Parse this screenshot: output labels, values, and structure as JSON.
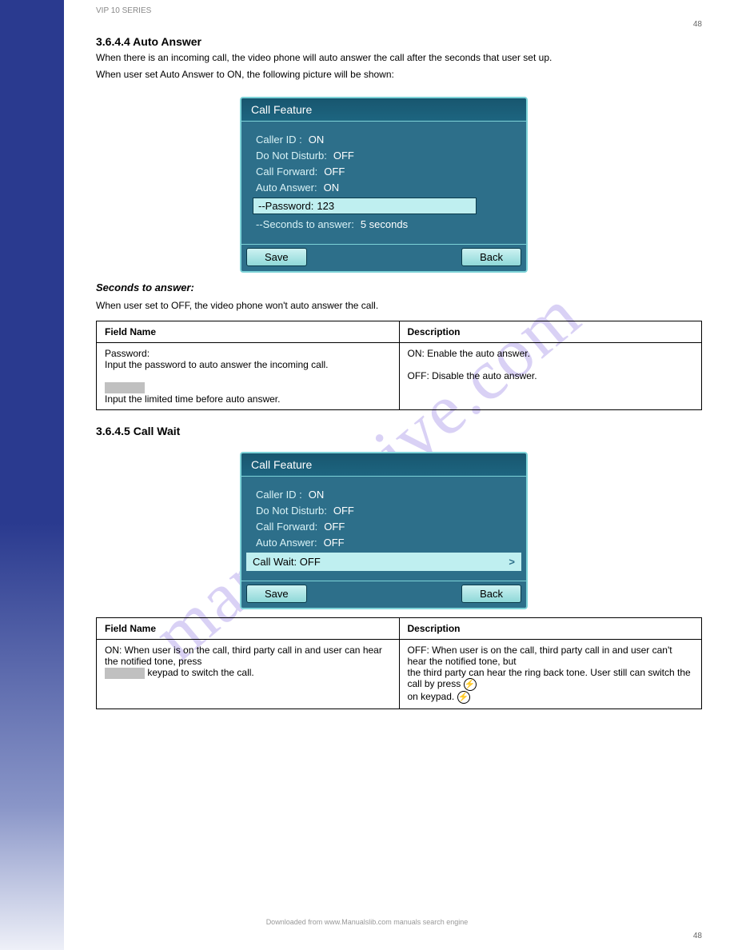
{
  "header": "VIP 10 SERIES",
  "page_number_top": "48",
  "page_number_bottom": "48",
  "footer_copy": "Downloaded from www.Manualslib.com manuals search engine",
  "watermark": "manualshive.com",
  "section": {
    "heading": "3.6.4.4 Auto Answer",
    "intro_line1": "When there is an incoming call, the video phone will auto answer the call after the seconds that user set up.",
    "intro_line2": "When user set Auto Answer to ON, the following picture will be shown:",
    "note_heading": "Seconds to answer:",
    "note_body": "When user set to OFF, the video phone won't auto answer the call."
  },
  "panel1": {
    "title": "Call Feature",
    "rows": {
      "caller_id_label": "Caller ID :",
      "caller_id_value": "ON",
      "dnd_label": "Do Not Disturb:",
      "dnd_value": "OFF",
      "cfwd_label": "Call Forward:",
      "cfwd_value": "OFF",
      "aans_label": "Auto Answer:",
      "aans_value": "ON",
      "pwd_label": "--Password:",
      "pwd_value": "123",
      "secs_label": "--Seconds to answer:",
      "secs_value": "5 seconds"
    },
    "save": "Save",
    "back": "Back"
  },
  "table1": {
    "h1": "Field Name",
    "h2": "Description",
    "r1c1_a": "Password:",
    "r1c1_b": "Input the password to auto answer the incoming call.",
    "r1c1_c": "Input the limited time before auto answer.",
    "r1c2_a": "ON: Enable the auto answer.",
    "r1c2_b": "OFF: Disable the auto answer."
  },
  "section2": {
    "heading": "3.6.4.5 Call Wait"
  },
  "panel2": {
    "title": "Call Feature",
    "rows": {
      "caller_id_label": "Caller ID :",
      "caller_id_value": "ON",
      "dnd_label": "Do Not Disturb:",
      "dnd_value": "OFF",
      "cfwd_label": "Call Forward:",
      "cfwd_value": "OFF",
      "aans_label": "Auto Answer:",
      "aans_value": "OFF",
      "cwait_label": "Call Wait:",
      "cwait_value": "OFF"
    },
    "arrow": ">",
    "save": "Save",
    "back": "Back"
  },
  "table2": {
    "h1": "Field Name",
    "h2": "Description",
    "r1c1_a": "ON: When user is on the call, third party call in and user can hear the notified tone, press",
    "r1c1_b": "keypad to switch the call.",
    "r1c2_a": "OFF: When user is on the call, third party call in and user can't hear the notified tone, but",
    "r1c2_b": "the third party can hear the ring back tone. User still can switch the call by press",
    "r1c2_c": "on keypad."
  }
}
